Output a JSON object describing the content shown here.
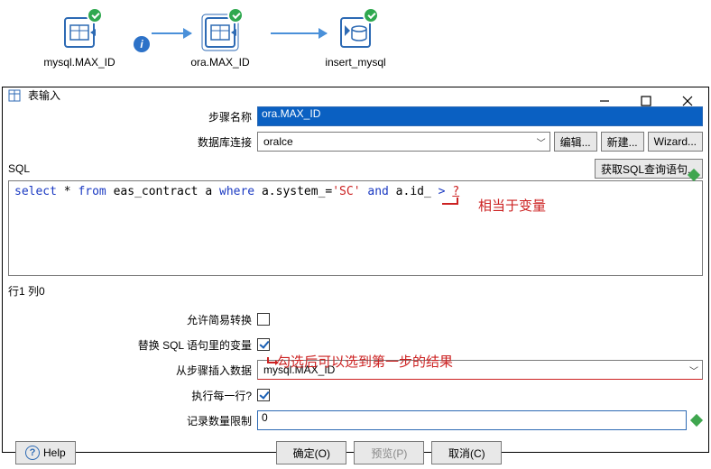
{
  "flow": {
    "nodes": [
      {
        "label": "mysql.MAX_ID"
      },
      {
        "label": "ora.MAX_ID"
      },
      {
        "label": "insert_mysql"
      }
    ]
  },
  "dialog": {
    "title": "表输入",
    "win": {
      "min": "—",
      "max": "▢",
      "close": "X"
    },
    "step_name_label": "步骤名称",
    "step_name_value": "ora.MAX_ID",
    "db_conn_label": "数据库连接",
    "db_conn_value": "oralce",
    "edit_btn": "编辑...",
    "new_btn": "新建...",
    "wizard_btn": "Wizard...",
    "sql_label": "SQL",
    "get_sql_btn": "获取SQL查询语句...",
    "sql": {
      "p1": "select",
      "p2": " * ",
      "p3": "from",
      "p4": " eas_contract a ",
      "p5": "where",
      "p6": " a.system_=",
      "p7": "'SC'",
      "p8": " ",
      "p9": "and",
      "p10": " a.id_ ",
      "p11": ">",
      "p12": " ",
      "p13": "?"
    },
    "sql_annotation": "相当于变量",
    "linecol": "行1 列0",
    "allow_simple_label": "允许简易转换",
    "allow_simple_checked": false,
    "replace_var_label": "替换 SQL 语句里的变量",
    "replace_var_checked": true,
    "replace_annotation": "勾选后可以选到第一步的结果",
    "insert_from_step_label": "从步骤插入数据",
    "insert_from_step_value": "mysql.MAX_ID",
    "exec_each_row_label": "执行每一行?",
    "exec_each_row_checked": true,
    "record_limit_label": "记录数量限制",
    "record_limit_value": "0",
    "help_btn": "Help",
    "ok_btn": "确定(O)",
    "preview_btn": "预览(P)",
    "cancel_btn": "取消(C)"
  }
}
